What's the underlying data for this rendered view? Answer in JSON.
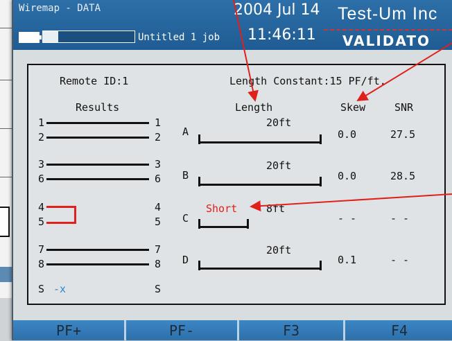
{
  "header": {
    "title": "Wiremap - DATA",
    "progress_text": "17%",
    "progress_value": 0.17,
    "job": "Untitled 1 job",
    "date": "2004 Jul 14",
    "time": "11:46:11",
    "brand": "Test-Um Inc",
    "model": "VALIDATO"
  },
  "panel": {
    "remote_id": "Remote ID:1",
    "length_constant": "Length Constant:15 PF/ft.",
    "results_header": "Results",
    "length_header": "Length",
    "skew_header": "Skew",
    "snr_header": "SNR",
    "pairs": [
      {
        "pins_left": [
          "1",
          "2"
        ],
        "pins_right": [
          "1",
          "2"
        ],
        "letter": "A",
        "status": "",
        "length": "20ft",
        "skew": "0.0",
        "snr": "27.5"
      },
      {
        "pins_left": [
          "3",
          "6"
        ],
        "pins_right": [
          "3",
          "6"
        ],
        "letter": "B",
        "status": "",
        "length": "20ft",
        "skew": "0.0",
        "snr": "28.5"
      },
      {
        "pins_left": [
          "4",
          "5"
        ],
        "pins_right": [
          "4",
          "5"
        ],
        "letter": "C",
        "status": "Short",
        "length": "8ft",
        "skew": "- -",
        "snr": "- -"
      },
      {
        "pins_left": [
          "7",
          "8"
        ],
        "pins_right": [
          "7",
          "8"
        ],
        "letter": "D",
        "status": "",
        "length": "20ft",
        "skew": "0.1",
        "snr": "- -"
      }
    ],
    "shield_left": "S",
    "shield_mark": "-x",
    "shield_right": "S"
  },
  "footer": {
    "buttons": [
      "PF+",
      "PF-",
      "F3",
      "F4"
    ]
  },
  "colors": {
    "header_blue": "#2d6fa8",
    "fault_red": "#e0201a",
    "arrow_red": "#e0201a"
  }
}
